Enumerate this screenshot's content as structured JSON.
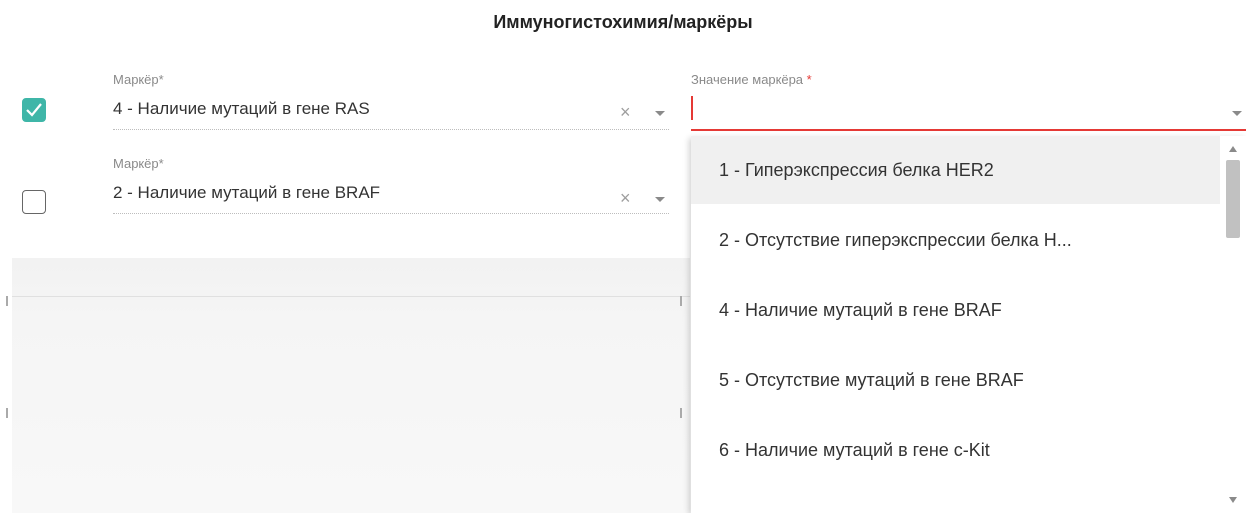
{
  "section": {
    "title": "Иммуногистохимия/маркёры"
  },
  "markers": [
    {
      "label": "Маркёр*",
      "value": "4 - Наличие мутаций в гене RAS",
      "checked": true,
      "clear_icon": "×"
    },
    {
      "label": "Маркёр*",
      "value": "2 - Наличие мутаций в гене BRAF",
      "checked": false,
      "clear_icon": "×"
    }
  ],
  "marker_value_field": {
    "label": "Значение маркёра ",
    "required_mark": "*",
    "value": ""
  },
  "dropdown": {
    "options": [
      "1 - Гиперэкспрессия белка HER2",
      "2 - Отсутствие гиперэкспрессии белка Н...",
      "4 - Наличие мутаций в гене BRAF",
      "5 - Отсутствие мутаций в гене BRAF",
      "6 - Наличие мутаций в гене c-Kit"
    ],
    "hovered_option_index": 0
  },
  "colors": {
    "checkbox_checked": "#3fb6a8",
    "error": "#e53935",
    "hover": "#f0f0f0"
  },
  "icons": [
    "check-icon",
    "clear-icon",
    "chevron-down-icon",
    "scroll-up-icon",
    "scroll-down-icon"
  ]
}
